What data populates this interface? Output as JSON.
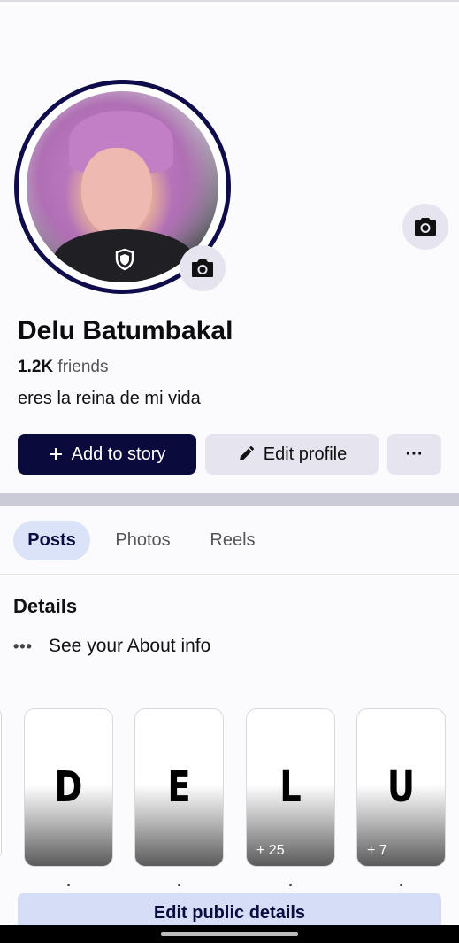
{
  "profile": {
    "name": "Delu Batumbakal",
    "friends_count": "1.2K",
    "friends_label": "friends",
    "bio": "eres la reina de mi vida"
  },
  "actions": {
    "add_story": "Add to story",
    "edit_profile": "Edit profile",
    "more": "···"
  },
  "tabs": [
    {
      "label": "Posts",
      "active": true
    },
    {
      "label": "Photos",
      "active": false
    },
    {
      "label": "Reels",
      "active": false
    }
  ],
  "details": {
    "title": "Details",
    "about": "See your About info",
    "about_dots": "•••"
  },
  "highlights": [
    {
      "letter": "D",
      "count": ""
    },
    {
      "letter": "E",
      "count": ""
    },
    {
      "letter": "L",
      "count": "+ 25"
    },
    {
      "letter": "U",
      "count": "+ 7"
    }
  ],
  "edit_public": "Edit public details",
  "colors": {
    "primary_dark": "#0b0a3d",
    "button_gray": "#e6e4ef",
    "tab_active_bg": "#dbe3f8",
    "edit_public_bg": "#d6def7"
  },
  "icons": [
    "camera-icon",
    "shield-icon",
    "plus-icon",
    "pencil-icon"
  ]
}
